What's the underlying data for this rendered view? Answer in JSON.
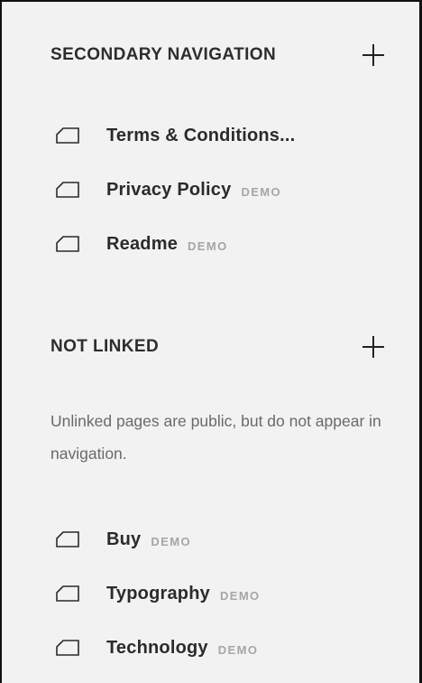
{
  "secondary_navigation": {
    "title": "SECONDARY NAVIGATION",
    "add_icon": "plus-icon",
    "items": [
      {
        "label": "Terms & Conditions...",
        "badge": "",
        "icon": "page-icon"
      },
      {
        "label": "Privacy Policy",
        "badge": "DEMO",
        "icon": "page-icon"
      },
      {
        "label": "Readme",
        "badge": "DEMO",
        "icon": "page-icon"
      }
    ]
  },
  "not_linked": {
    "title": "NOT LINKED",
    "add_icon": "plus-icon",
    "note": "Unlinked pages are public, but do not appear in navigation.",
    "items": [
      {
        "label": "Buy",
        "badge": "DEMO",
        "icon": "page-icon"
      },
      {
        "label": "Typography",
        "badge": "DEMO",
        "icon": "page-icon"
      },
      {
        "label": "Technology",
        "badge": "DEMO",
        "icon": "page-icon"
      }
    ]
  },
  "colors": {
    "panel_background": "#f2f2f2",
    "title_text": "#2d2d2d",
    "note_text": "#6a6a6a",
    "badge_text": "#a6a6a6",
    "border": "#111111"
  }
}
